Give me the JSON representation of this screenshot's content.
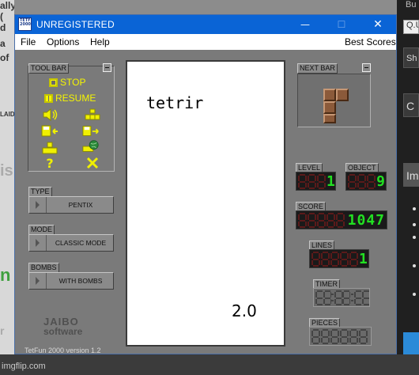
{
  "window": {
    "title": "UNREGISTERED",
    "icon_text": "TETFUN 2000",
    "controls": {
      "minimize": "—",
      "maximize": "☐",
      "close": "✕"
    }
  },
  "menu": {
    "file": "File",
    "options": "Options",
    "help": "Help",
    "best_scores": "Best Scores"
  },
  "toolbar": {
    "label": "TOOL BAR",
    "stop": "STOP",
    "resume": "RESUME",
    "icons": [
      "sound-icon",
      "grid-icon",
      "save-icon",
      "load-icon",
      "stack-icon",
      "globe-icon",
      "help-icon",
      "exit-icon"
    ]
  },
  "type": {
    "label": "TYPE",
    "value": "PENTIX"
  },
  "mode": {
    "label": "MODE",
    "value": "CLASSIC MODE"
  },
  "bombs": {
    "label": "BOMBS",
    "value": "WITH BOMBS"
  },
  "brand": {
    "line1": "JAIBO",
    "line2": "software",
    "version": "TetFun 2000 version 1.2"
  },
  "playfield": {
    "title": "tetrir",
    "version": "2.0"
  },
  "next_bar": {
    "label": "NEXT BAR"
  },
  "level": {
    "label": "LEVEL",
    "value": "1"
  },
  "object": {
    "label": "OBJECT",
    "value": "9"
  },
  "score": {
    "label": "SCORE",
    "value": "1047"
  },
  "lines": {
    "label": "LINES",
    "value": "1"
  },
  "timer": {
    "label": "TIMER"
  },
  "pieces": {
    "label": "PIECES"
  },
  "colors": {
    "titlebar": "#0a64d6",
    "lcd_green": "#22e022",
    "block": "#8b5a3a",
    "toolbar_yellow": "#f5f500"
  },
  "background": {
    "left_fragments": [
      "ally (",
      "d",
      "a",
      "of",
      "LAID",
      "is",
      "n",
      "r"
    ],
    "right_fragments": [
      "Bu",
      "Q.U",
      "Sh",
      "C",
      "Im"
    ],
    "watermark": "imgflip.com"
  }
}
